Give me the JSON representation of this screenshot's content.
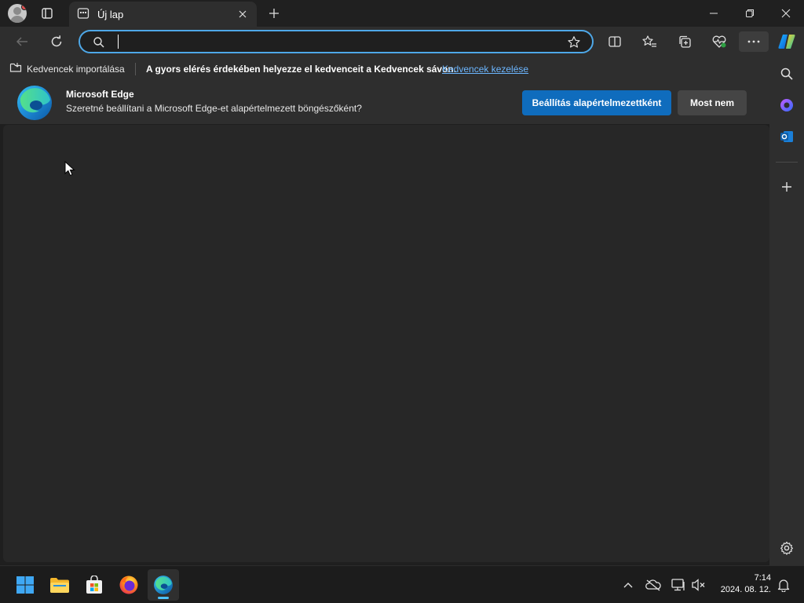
{
  "tab": {
    "title": "Új lap"
  },
  "address": {
    "value": "",
    "placeholder": ""
  },
  "favorites_bar": {
    "import_label": "Kedvencek importálása",
    "message": "A gyors elérés érdekében helyezze el kedvenceit a Kedvencek sávon.",
    "manage_link": "Kedvencek kezelése"
  },
  "infobar": {
    "title": "Microsoft Edge",
    "text": "Szeretné beállítani a Microsoft Edge-et alapértelmezett böngészőként?",
    "primary_button": "Beállítás alapértelmezettként",
    "secondary_button": "Most nem"
  },
  "taskbar": {
    "time": "7:14",
    "date": "2024. 08. 12."
  },
  "colors": {
    "accent": "#4ea8e8",
    "primary_button": "#0f6cbd",
    "link": "#6cb6ff",
    "background": "#1f1f1f"
  },
  "icons": {
    "titlebar": [
      "profile-icon",
      "tab-actions-icon",
      "new-tab-page-icon",
      "close-icon",
      "plus-icon",
      "minimize-icon",
      "restore-icon",
      "window-close-icon"
    ],
    "toolbar": [
      "back-arrow-icon",
      "refresh-icon",
      "search-icon",
      "star-icon",
      "split-screen-icon",
      "favorites-icon",
      "collections-icon",
      "browser-essentials-icon",
      "more-icon",
      "copilot-icon"
    ],
    "sidebar": [
      "search-icon",
      "copilot-icon",
      "outlook-icon",
      "plus-icon",
      "settings-icon"
    ],
    "taskbar": [
      "windows-start-icon",
      "file-explorer-icon",
      "microsoft-store-icon",
      "firefox-icon",
      "edge-icon",
      "chevron-up-icon",
      "onedrive-icon",
      "network-icon",
      "volume-muted-icon",
      "notification-bell-icon"
    ]
  }
}
